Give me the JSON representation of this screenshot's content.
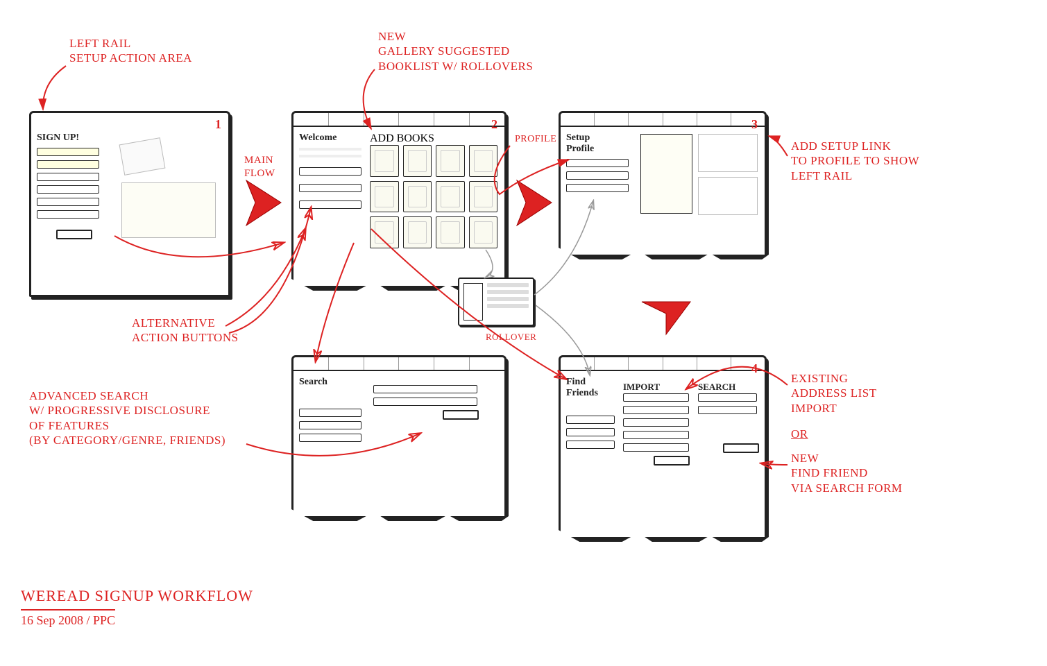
{
  "annotations": {
    "left_rail": "LEFT RAIL\nSETUP ACTION AREA",
    "main_flow": "MAIN\nFLOW",
    "new_gallery": "NEW\nGALLERY SUGGESTED\nBOOKLIST W/ ROLLOVERS",
    "profile": "PROFILE",
    "rollover": "ROLLOVER",
    "add_setup": "ADD SETUP LINK\nTO PROFILE TO SHOW\nLEFT RAIL",
    "alt_actions": "ALTERNATIVE\nACTION BUTTONS",
    "adv_search": "ADVANCED SEARCH\nW/ PROGRESSIVE DISCLOSURE\nOF FEATURES\n(BY CATEGORY/GENRE, FRIENDS)",
    "existing_import": "EXISTING\nADDRESS LIST\nIMPORT",
    "or": "OR",
    "new_find": "NEW\nFIND FRIEND\nVIA SEARCH FORM"
  },
  "panels": {
    "p1": {
      "num": "1",
      "title": "SIGN UP!"
    },
    "p2": {
      "num": "2",
      "left_title": "Welcome",
      "main_title": "ADD BOOKS"
    },
    "p3": {
      "num": "3",
      "title": "Setup\nProfile"
    },
    "p4_search": {
      "title": "Search"
    },
    "p5_friends": {
      "num": "4",
      "title": "Find\nFriends",
      "col1": "IMPORT",
      "col2": "SEARCH"
    }
  },
  "footer": {
    "title": "WEREAD SIGNUP WORKFLOW",
    "date": "16 Sep 2008 / PPC"
  }
}
